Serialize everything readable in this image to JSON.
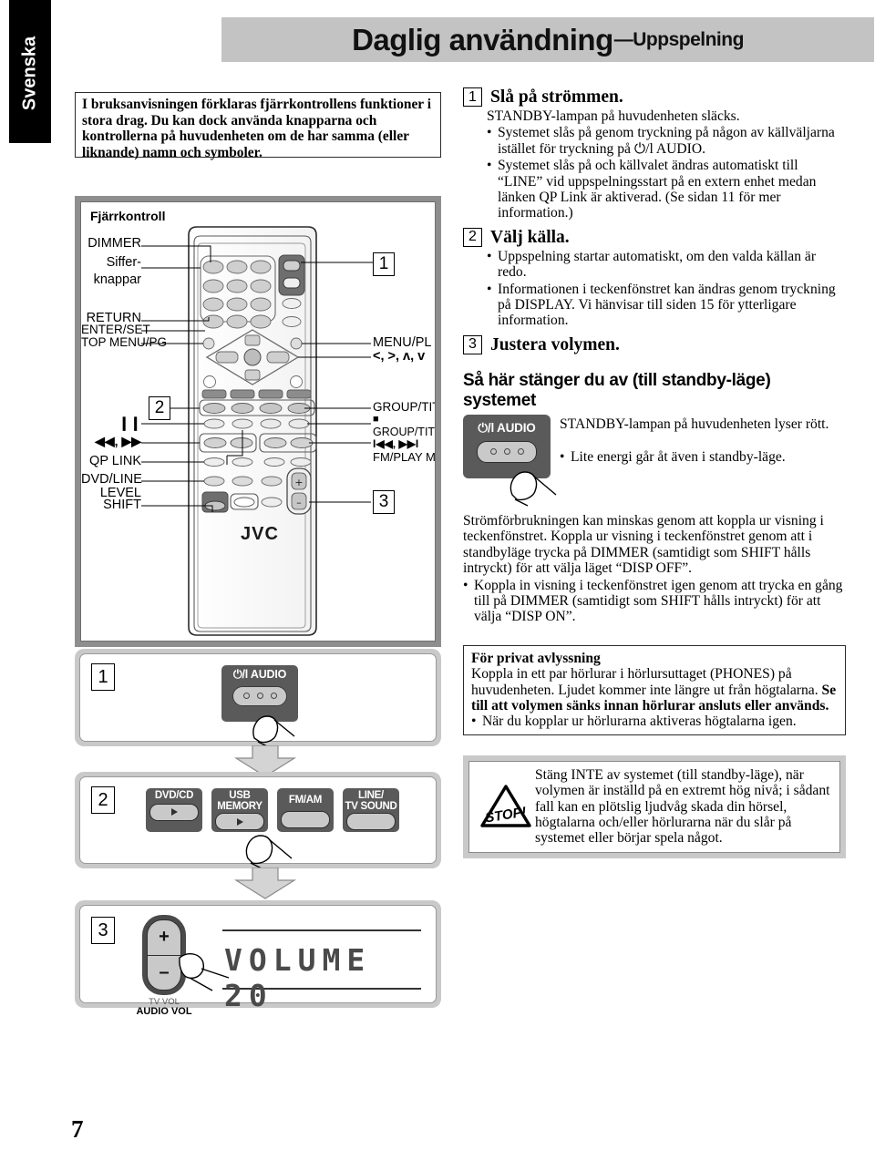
{
  "language_tab": "Svenska",
  "header": {
    "title_main": "Daglig användning",
    "title_sub": "—Uppspelning"
  },
  "intro_box": {
    "text": "I bruksanvisningen förklaras fjärrkontrollens funktioner i stora drag. Du kan dock använda knapparna och kontrollerna på huvudenheten om de har samma (eller liknande) namn och symboler."
  },
  "illustration": {
    "caption": "Fjärrkontroll",
    "brand": "JVC",
    "left_labels": [
      "DIMMER",
      "Siffer-",
      "knappar",
      "RETURN",
      "ENTER/SET",
      "TOP MENU/PG",
      "QP LINK",
      "DVD/LINE",
      "LEVEL",
      "SHIFT"
    ],
    "pause_symbol": "❙❙",
    "skip_symbol": "◀◀, ▶▶",
    "right_labels": [
      "MENU/PL",
      "GROUP/TITLE",
      "GROUP/TITLE SKIP",
      "FM/PLAY MODE"
    ],
    "cursor_symbols": "<, >, ʌ, v",
    "stop_symbol": "■",
    "skip_symbols_right": "I◀◀,  ▶▶I",
    "callout_1": "1",
    "callout_2": "2",
    "callout_3": "3"
  },
  "flow": {
    "step1_marker": "1",
    "step2_marker": "2",
    "step3_marker": "3",
    "power_button_label": "⏻/l AUDIO",
    "source_buttons": [
      {
        "line1": "DVD/CD",
        "line2": "",
        "has_play": true
      },
      {
        "line1": "USB",
        "line2": "MEMORY",
        "has_play": true
      },
      {
        "line1": "FM/AM",
        "line2": "",
        "has_play": false
      },
      {
        "line1": "LINE/",
        "line2": "TV SOUND",
        "has_play": false
      }
    ],
    "vol_plus": "+",
    "vol_minus": "–",
    "vol_label_1": "TV VOL",
    "vol_label_2": "AUDIO VOL",
    "display_text": "VOLUME 20"
  },
  "steps": [
    {
      "num": "1",
      "heading": "Slå på strömmen.",
      "lead": "STANDBY-lampan på huvudenheten släcks.",
      "bullets": [
        "Systemet slås på genom tryckning på någon av källväljarna istället för tryckning på ⏻/l AUDIO.",
        "Systemet slås på och källvalet ändras automatiskt till “LINE” vid uppspelningsstart på en extern enhet medan länken QP Link är aktiverad. (Se sidan 11 för mer information.)"
      ]
    },
    {
      "num": "2",
      "heading": "Välj källa.",
      "lead": "",
      "bullets": [
        "Uppspelning startar automatiskt, om den valda källan är redo.",
        "Informationen i teckenfönstret kan ändras genom tryckning på DISPLAY. Vi hänvisar till siden 15 för ytterligare information."
      ]
    },
    {
      "num": "3",
      "heading": "Justera volymen.",
      "lead": "",
      "bullets": []
    }
  ],
  "standby_section": {
    "heading": "Så här stänger du av (till standby-läge) systemet",
    "power_caption": "⏻/l AUDIO",
    "lead": "STANDBY-lampan på huvudenheten lyser rött.",
    "bullet": "Lite energi går åt även i standby-läge."
  },
  "dimmer_note": {
    "paragraph": "Strömförbrukningen kan minskas genom att koppla ur visning i teckenfönstret. Koppla ur visning i teckenfönstret genom att i standbyläge trycka på DIMMER (samtidigt som SHIFT hålls intryckt) för att välja läget “DISP OFF”.",
    "bullet": "Koppla in visning i teckenfönstret igen genom att trycka en gång till på DIMMER (samtidigt som SHIFT hålls intryckt) för att välja “DISP ON”."
  },
  "private_box": {
    "heading": "För privat avlyssning",
    "body_normal_1": "Koppla in ett par hörlurar i hörlursuttaget (PHONES) på huvudenheten. Ljudet kommer inte längre ut från högtalarna. ",
    "body_bold": "Se till att volymen sänks innan hörlurar ansluts eller används.",
    "bullet": "När du kopplar ur hörlurarna aktiveras högtalarna igen."
  },
  "warning_box": {
    "icon_text": "STOP!",
    "text": "Stäng INTE av systemet (till standby-läge), när volymen är inställd på en extremt hög nivå; i sådant fall kan en plötslig ljudvåg skada din hörsel, högtalarna och/eller hörlurarna när du slår på systemet eller börjar spela något."
  },
  "page_number": "7"
}
